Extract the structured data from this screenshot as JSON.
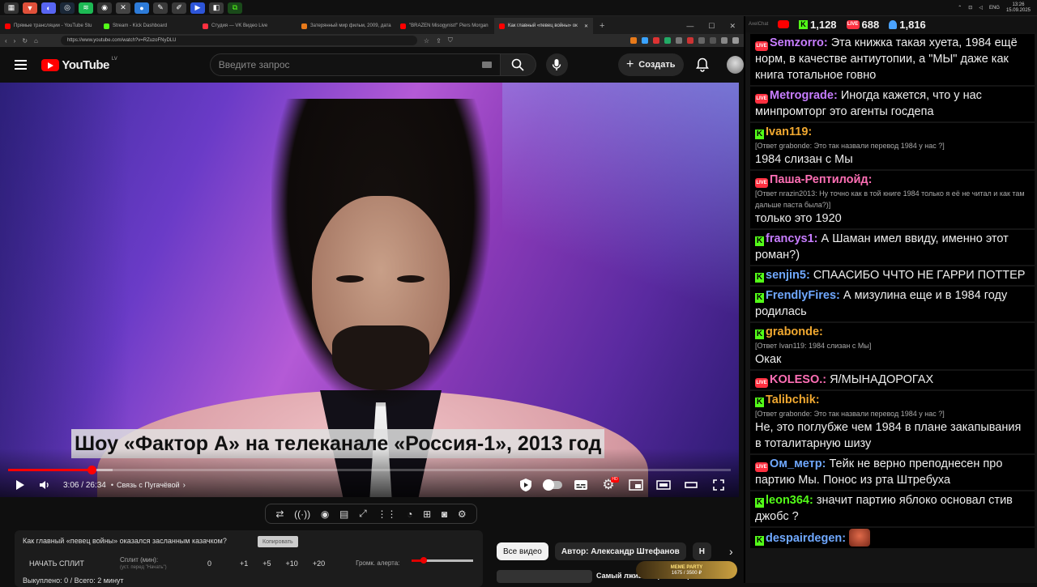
{
  "browser": {
    "tabs": [
      {
        "label": "Прямые трансляции - YouTube Stu",
        "color": "#ff0000"
      },
      {
        "label": "Stream - Kick Dashboard",
        "color": "#53fc18"
      },
      {
        "label": "Студия — VK Видео Live",
        "color": "#ff3040"
      },
      {
        "label": "Затерянный мир фильм, 2009, дата",
        "color": "#e87a1a"
      },
      {
        "label": "\"BRAZEN Misogynist!\" Piers Morgan",
        "color": "#ff0000"
      },
      {
        "label": "Как главный «певец войны» ок",
        "color": "#ff0000"
      }
    ],
    "url": "https://www.youtube.com/watch?v=RZuzoFNyDLU",
    "clock_time": "13:26",
    "clock_date": "15.09.2025",
    "lang": "ENG"
  },
  "youtube": {
    "logo_text": "YouTube",
    "logo_country": "LV",
    "search_placeholder": "Введите запрос",
    "create_label": "Создать",
    "caption": "Шоу «Фактор А» на телеканале «Россия-1», 2013 год",
    "progress_fraction": 0.116,
    "buffered_fraction": 0.145,
    "time_current": "3:06",
    "time_total": "26:34",
    "chapter": "Связь с Пугачёвой",
    "chips": [
      "Все видео",
      "Автор: Александр Штефанов",
      "Н"
    ],
    "rec_title": "Самый лживый фильм про"
  },
  "extension_panel": {
    "video_title": "Как главный «певец войны» оказался засланным казачком?",
    "copy_label": "Копировать",
    "split_label": "НАЧАТЬ СПЛИТ",
    "split_min_label": "Сплит (мин):",
    "split_min_hint": "(уст. перед \"Начать\")",
    "split_value": "0",
    "increments": [
      "+1",
      "+5",
      "+10",
      "+20"
    ],
    "alert_label": "Громк. алерта:",
    "alert_volume_fraction": 0.18,
    "stats": "Выкуплено: 0 / Всего: 2 минут"
  },
  "badge": {
    "title": "MEME PARTY",
    "count": "1675 / 3500 ₽"
  },
  "chat": {
    "app_label": "AxelChat",
    "stats": {
      "youtube": "1,128",
      "kick": "1,128",
      "vk": "688",
      "viewers": "1,816"
    },
    "messages": [
      {
        "src": "vk",
        "name": "Semzorro:",
        "color": "#c77dff",
        "reply": "",
        "text": "Эта книжка такая хуета, 1984 ещё норм, в качестве антиутопии, а \"МЫ\" даже как книга тотальное говно"
      },
      {
        "src": "vk",
        "name": "Metrograde:",
        "color": "#c77dff",
        "reply": "",
        "text": "Иногда кажется, что у нас минпромторг это агенты госдепа"
      },
      {
        "src": "kick",
        "name": "Ivan119:",
        "color": "#f0a830",
        "reply": "[Ответ grabonde: Это так назвали перевод 1984 у нас ?]",
        "text": "1984 слизан с Мы"
      },
      {
        "src": "vk",
        "name": "Паша-Рептилойд:",
        "color": "#ff6fb5",
        "reply": "[Ответ nrazin2013: Ну точно как в той книге 1984 только я её не читал и как там дальше паста была?)]",
        "text": "только это 1920"
      },
      {
        "src": "kick",
        "name": "francys1:",
        "color": "#c77dff",
        "reply": "",
        "text": "А Шаман имел ввиду, именно этот роман?)"
      },
      {
        "src": "kick",
        "name": "senjin5:",
        "color": "#6fa8ff",
        "reply": "",
        "text": "СПААСИБО ЧЧТО НЕ ГАРРИ ПОТТЕР"
      },
      {
        "src": "kick",
        "name": "FrendlyFires:",
        "color": "#6fa8ff",
        "reply": "",
        "text": "А мизулина еще и в 1984 году родилась"
      },
      {
        "src": "kick",
        "name": "grabonde:",
        "color": "#f0a830",
        "reply": "[Ответ Ivan119: 1984 слизан с Мы]",
        "text": "Окак"
      },
      {
        "src": "vk",
        "name": "KOLESO.:",
        "color": "#ff6fb5",
        "reply": "",
        "text": "Я/МЫНАДОРОГАХ"
      },
      {
        "src": "kick",
        "name": "Talibchik:",
        "color": "#f0a830",
        "reply": "[Ответ grabonde: Это так назвали перевод 1984 у нас ?]",
        "text": "Не, это поглубже чем 1984 в плане закапывания в тоталитарную шизу"
      },
      {
        "src": "vk",
        "name": "Ом_метр:",
        "color": "#6fa8ff",
        "reply": "",
        "text": "Тейк не верно преподнесен про партию Мы. Понос из рта Штребуха"
      },
      {
        "src": "kick",
        "name": "leon364:",
        "color": "#53fc18",
        "reply": "",
        "text": "значит партию яблоко основал стив джобс ?"
      },
      {
        "src": "kick",
        "name": "despairdegen:",
        "color": "#6fa8ff",
        "reply": "",
        "text": ""
      }
    ]
  }
}
